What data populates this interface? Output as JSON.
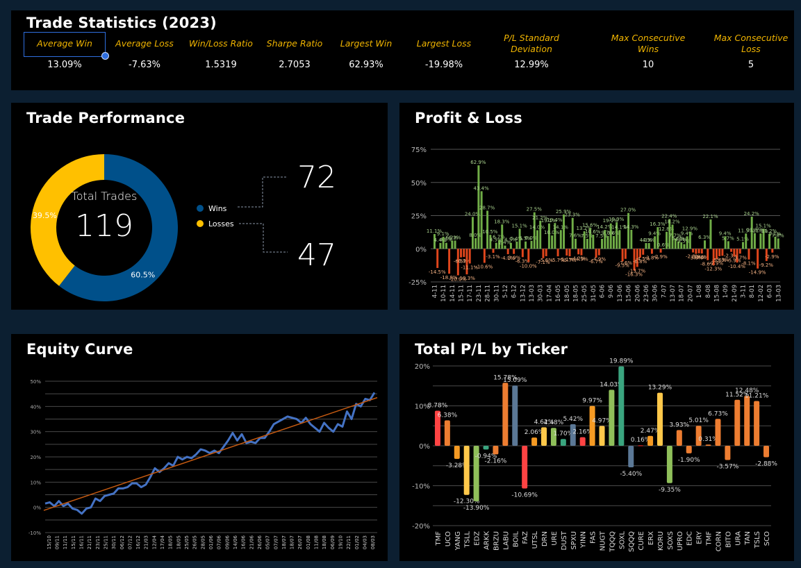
{
  "stats": {
    "title": "Trade Statistics (2023)",
    "items": [
      {
        "label": "Average Win",
        "value": "13.09%"
      },
      {
        "label": "Average Loss",
        "value": "-7.63%"
      },
      {
        "label": "Win/Loss Ratio",
        "value": "1.5319"
      },
      {
        "label": "Sharpe Ratio",
        "value": "2.7053"
      },
      {
        "label": "Largest Win",
        "value": "62.93%"
      },
      {
        "label": "Largest Loss",
        "value": "-19.98%"
      },
      {
        "label": "P/L Standard Deviation",
        "value": "12.99%"
      },
      {
        "label": "Max Consecutive Wins",
        "value": "10"
      },
      {
        "label": "Max Consecutive Loss",
        "value": "5"
      }
    ],
    "selection_color": "#2f6fe0"
  },
  "chart_data": [
    {
      "type": "pie",
      "title": "Trade Performance",
      "center_label": "Total Trades",
      "center_value": "119",
      "categories": [
        "Wins",
        "Losses"
      ],
      "values": [
        72,
        47
      ],
      "percent_labels": [
        "60.5%",
        "39.5%"
      ],
      "count_labels": [
        "72",
        "47"
      ],
      "colors": [
        "#00508a",
        "#ffc000"
      ],
      "legend": "right"
    },
    {
      "type": "bar",
      "title": "Profit & Loss",
      "ylim": [
        -25,
        75
      ],
      "yticks": [
        "75%",
        "50%",
        "25%",
        "0%",
        "-25%"
      ],
      "ytick_values": [
        75,
        50,
        25,
        0,
        -25
      ],
      "grid": true,
      "colors": {
        "positive": "#70ad47",
        "negative": "#e0461c"
      },
      "xtick_labels": [
        "4-11",
        "10-11",
        "14-11",
        "15-11",
        "17-11",
        "23-11",
        "28-11",
        "30-11",
        "5-12",
        "6-12",
        "13-12",
        "13-03",
        "30-03",
        "17-04",
        "16-05",
        "18-05",
        "18-05",
        "25-05",
        "31-05",
        "6-06",
        "9-06",
        "13-06",
        "15-06",
        "20-06",
        "23-06",
        "30-06",
        "7-07",
        "13-07",
        "18-07",
        "20-07",
        "1-08",
        "8-08",
        "15-08",
        "1-09",
        "21-09",
        "3-11",
        "8-01",
        "12-02",
        "6-03",
        "13-03"
      ],
      "values": [
        11.1,
        -14.5,
        4.4,
        9.1,
        4.5,
        -18.8,
        6.2,
        6.2,
        -20.0,
        -6.5,
        -6.2,
        -19.3,
        -11.1,
        24.0,
        8.0,
        62.9,
        43.4,
        -10.6,
        28.7,
        10.5,
        -3.1,
        4.5,
        6.7,
        18.3,
        2.4,
        -4.1,
        4.5,
        -3.9,
        5.4,
        15.1,
        -6.3,
        5.5,
        -10.0,
        6.0,
        27.5,
        14.0,
        21.2,
        -7.1,
        -5.6,
        19.1,
        10.0,
        19.4,
        -5.7,
        14.1,
        25.9,
        -5.1,
        -5.7,
        23.3,
        7.6,
        -4.2,
        -4.9,
        13.2,
        7.5,
        15.6,
        10.6,
        -6.7,
        -4.9,
        7.5,
        14.2,
        9.7,
        19.1,
        9.6,
        19.9,
        14.1,
        -9.5,
        -7.6,
        27.0,
        14.3,
        -16.3,
        -13.7,
        -6.8,
        -4.5,
        4.3,
        4.3,
        -3.8,
        9.4,
        16.3,
        -2.9,
        0.6,
        12.8,
        22.4,
        18.2,
        7.7,
        5.6,
        4.8,
        3.5,
        9.4,
        12.9,
        -2.8,
        -3.8,
        -3.4,
        -3.6,
        6.3,
        -8.6,
        22.1,
        -12.3,
        -7.9,
        -5.6,
        -5.3,
        9.4,
        5.7,
        -2.3,
        -5.9,
        -10.4,
        -3.7,
        5.1,
        11.5,
        -8.1,
        24.2,
        11.8,
        -14.9,
        11.5,
        15.1,
        -9.2,
        11.2,
        -2.9,
        9.1,
        7.8
      ]
    },
    {
      "type": "line",
      "title": "Equity Curve",
      "ylim": [
        -10,
        50
      ],
      "yticks": [
        "50%",
        "40%",
        "30%",
        "20%",
        "10%",
        "0%",
        "-10%"
      ],
      "ytick_values": [
        50,
        40,
        30,
        20,
        10,
        0,
        -10
      ],
      "grid": true,
      "xtick_labels": [
        "15/10",
        "09/11",
        "11/11",
        "15/11",
        "16/11",
        "21/11",
        "23/11",
        "25/11",
        "30/11",
        "06/12",
        "07/12",
        "16/12",
        "21/03",
        "12/04",
        "17/04",
        "18/05",
        "18/05",
        "25/05",
        "26/05",
        "28/05",
        "01/06",
        "07/06",
        "09/06",
        "14/06",
        "16/06",
        "21/06",
        "26/06",
        "05/07",
        "07/07",
        "18/07",
        "18/07",
        "26/07",
        "01/08",
        "11/08",
        "18/08",
        "06/09",
        "19/10",
        "22/11",
        "01/02",
        "04/03",
        "08/03"
      ],
      "series": [
        {
          "values": [
            1.5,
            2,
            0.5,
            2.5,
            0.5,
            1.5,
            -0.5,
            -1,
            -2.5,
            -0.5,
            0,
            3.5,
            2.5,
            4.5,
            5,
            5.5,
            7.5,
            7.5,
            8,
            9.5,
            9.5,
            8,
            9,
            12,
            15.5,
            14,
            15.5,
            17.5,
            16.5,
            20,
            19,
            20,
            19.5,
            21,
            23,
            22.5,
            21.5,
            22.5,
            21.5,
            24,
            26.5,
            29.5,
            26.5,
            29,
            25.5,
            26,
            25.5,
            27.5,
            27.5,
            30,
            33,
            34,
            35,
            36,
            35.5,
            35,
            33.5,
            35.5,
            33,
            31.5,
            30,
            33.5,
            31.5,
            30,
            33,
            32,
            38,
            35,
            41,
            40,
            43,
            42.5,
            45.5
          ],
          "color": "#4472c4"
        }
      ],
      "trendline": {
        "start": -1.2,
        "end": 43.5,
        "color": "#c55a11"
      }
    },
    {
      "type": "bar",
      "title": "Total P/L by Ticker",
      "ylim": [
        -20,
        20
      ],
      "yticks": [
        "20%",
        "10%",
        "0%",
        "-10%",
        "-20%"
      ],
      "ytick_values": [
        20,
        10,
        0,
        -10,
        -20
      ],
      "grid": true,
      "categories": [
        "TMF",
        "UCO",
        "YANG",
        "TSLL",
        "EDZ",
        "ARKK",
        "BRZU",
        "LABU",
        "BOIL",
        "FAZ",
        "UTSL",
        "DRN",
        "URE",
        "DUST",
        "SPXU",
        "YINN",
        "FAS",
        "NUGT",
        "TQQQ",
        "SOXL",
        "SQQQ",
        "CURE",
        "ERX",
        "KORU",
        "SOXS",
        "UPRO",
        "EDC",
        "ERY",
        "TMF",
        "CORN",
        "BITO",
        "URA",
        "TAN",
        "TSLS",
        "SCO"
      ],
      "values": [
        8.78,
        6.38,
        -3.28,
        -12.3,
        -13.9,
        -0.94,
        -2.16,
        15.78,
        15.09,
        -10.69,
        2.06,
        4.62,
        4.48,
        1.7,
        5.42,
        2.16,
        9.97,
        4.97,
        14.03,
        19.89,
        -5.4,
        0.16,
        2.47,
        13.29,
        -9.35,
        3.93,
        -1.9,
        5.01,
        0.31,
        6.73,
        -3.57,
        11.52,
        12.48,
        11.21,
        -2.88
      ],
      "data_labels": [
        "8.78%",
        "6.38%",
        "-3.28%",
        "-12.30%",
        "-13.90%",
        "-0.94%",
        "-2.16%",
        "15.78%",
        "15.09%",
        "-10.69%",
        "2.06%",
        "4.62%",
        "4.48%",
        "1.70%",
        "5.42%",
        "2.16%",
        "9.97%",
        "4.97%",
        "14.03%",
        "19.89%",
        "-5.40%",
        "0.16%",
        "2.47%",
        "13.29%",
        "-9.35%",
        "3.93%",
        "-1.90%",
        "5.01%",
        "0.31%",
        "6.73%",
        "-3.57%",
        "11.52%",
        "12.48%",
        "11.21%",
        "-2.88%"
      ],
      "colors": [
        "#ff4343",
        "#ed7d31",
        "#f59a23",
        "#ffc84a",
        "#8fbf5a",
        "#3aa57f",
        "#ed7d31",
        "#ed7d31",
        "#5b7896",
        "#ff4343",
        "#f59a23",
        "#ffc84a",
        "#8fbf5a",
        "#3aa57f",
        "#5b7896",
        "#ff4343",
        "#f59a23",
        "#ffc84a",
        "#8fbf5a",
        "#3aa57f",
        "#5b7896",
        "#b02020",
        "#f59a23",
        "#ffc84a",
        "#8fbf5a",
        "#ed7d31",
        "#ed7d31",
        "#ed7d31",
        "#ed7d31",
        "#ed7d31",
        "#ed7d31",
        "#ed7d31",
        "#ed7d31",
        "#ed7d31",
        "#ed7d31"
      ]
    }
  ]
}
